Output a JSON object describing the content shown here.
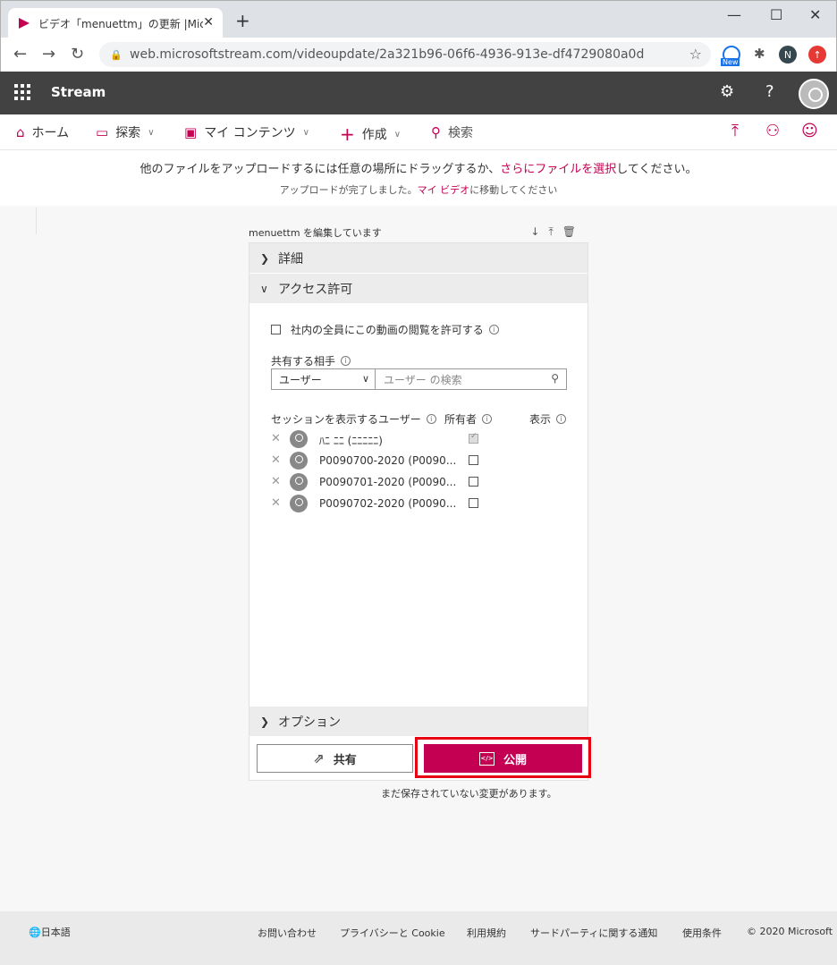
{
  "browser": {
    "tab_title": "ビデオ「menuettm」の更新 |Microsoft",
    "url": "web.microsoftstream.com/videoupdate/2a321b96-06f6-4936-913e-df4729080a0d",
    "ext_badge": "New",
    "profile_initial": "N"
  },
  "app": {
    "name": "Stream"
  },
  "nav": {
    "home": "ホーム",
    "explore": "探索",
    "my_content": "マイ コンテンツ",
    "create": "作成",
    "search": "検索"
  },
  "banner": {
    "line1_pre": "他のファイルをアップロードするには任意の場所にドラッグするか、",
    "line1_link": "さらにファイルを選択",
    "line1_post": "してください。",
    "line2_pre": "アップロードが完了しました。",
    "line2_link": "マイ ビデオ",
    "line2_post": "に移動してください"
  },
  "editor": {
    "heading": "menuettm を編集しています",
    "sections": {
      "details": "詳細",
      "access": "アクセス許可",
      "options": "オプション"
    },
    "allow_company": "社内の全員にこの動画の閲覧を許可する",
    "share_with": "共有する相手",
    "share_type": "ユーザー",
    "search_placeholder": "ユーザー の検索",
    "col_viewers": "セッションを表示するユーザー",
    "col_owner": "所有者",
    "col_display": "表示",
    "users": [
      {
        "name": "ﾊﾆ ﾆﾆ (ﾆﾆﾆﾆﾆ)",
        "owner": true
      },
      {
        "name": "P0090700-2020 (P0090...",
        "owner": false
      },
      {
        "name": "P0090701-2020 (P0090...",
        "owner": false
      },
      {
        "name": "P0090702-2020 (P0090...",
        "owner": false
      }
    ],
    "share_button": "共有",
    "publish_button": "公開",
    "unsaved": "まだ保存されていない変更があります。"
  },
  "footer": {
    "language": "日本語",
    "contact": "お問い合わせ",
    "privacy": "プライバシーと Cookie",
    "terms": "利用規約",
    "third_party": "サードパーティに関する通知",
    "conditions": "使用条件",
    "copyright": "© 2020 Microsoft"
  },
  "colors": {
    "accent": "#c30052",
    "header": "#424242",
    "highlight": "#e60012"
  }
}
